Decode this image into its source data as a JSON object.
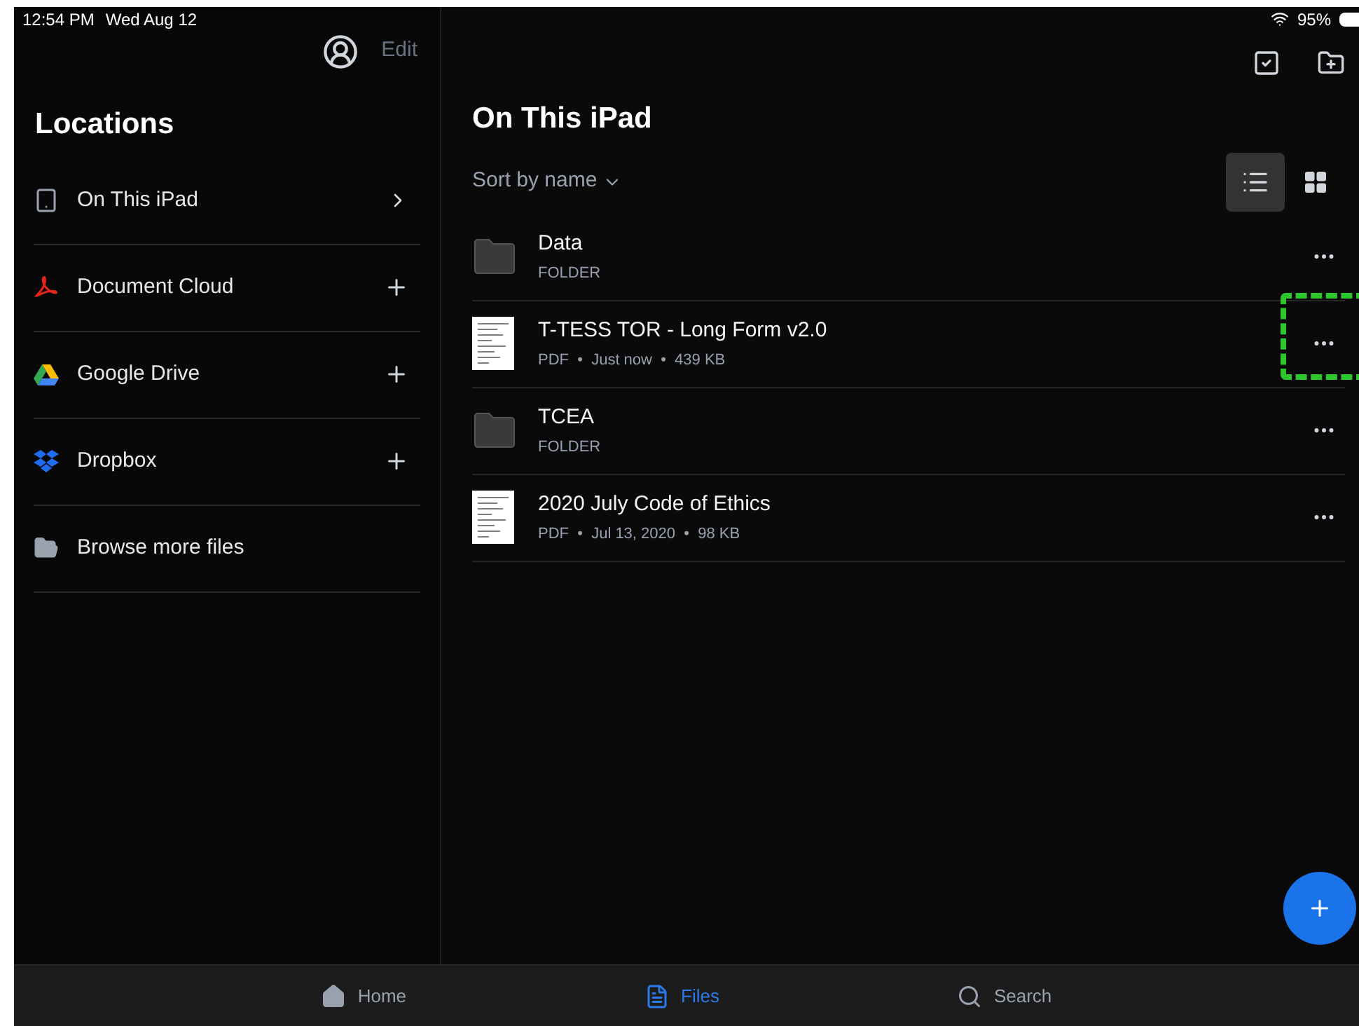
{
  "status_bar": {
    "time": "12:54 PM",
    "date": "Wed Aug 12",
    "battery": "95%"
  },
  "sidebar": {
    "edit": "Edit",
    "title": "Locations",
    "items": [
      {
        "label": "On This iPad",
        "kind": "ipad",
        "accessory": {
          "kind": "chevron"
        }
      },
      {
        "label": "Document Cloud",
        "kind": "acrobat",
        "accessory": {
          "kind": "add"
        }
      },
      {
        "label": "Google Drive",
        "kind": "drive",
        "accessory": {
          "kind": "add"
        }
      },
      {
        "label": "Dropbox",
        "kind": "dropbox",
        "accessory": {
          "kind": "add"
        }
      },
      {
        "label": "Browse more files",
        "kind": "folder"
      }
    ]
  },
  "main": {
    "title": "On This iPad",
    "sort": "Sort by name",
    "views": [
      {
        "kind": "list",
        "selected": true
      },
      {
        "kind": "grid",
        "selected": false
      }
    ],
    "files": [
      {
        "name": "Data",
        "kind": "folder",
        "meta": "FOLDER",
        "highlighted": false
      },
      {
        "name": "T-TESS TOR - Long Form v2.0",
        "kind": "pdf",
        "meta": "PDF  •  Just now  •  439 KB",
        "highlighted": true
      },
      {
        "name": "TCEA",
        "kind": "folder",
        "meta": "FOLDER",
        "highlighted": false
      },
      {
        "name": "2020 July Code of Ethics",
        "kind": "pdf",
        "meta": "PDF  •  Jul 13, 2020  •  98 KB",
        "highlighted": false
      }
    ]
  },
  "tab_bar": [
    {
      "label": "Home",
      "kind": "home",
      "selected": false
    },
    {
      "label": "Files",
      "kind": "files",
      "selected": true
    },
    {
      "label": "Search",
      "kind": "search",
      "selected": false
    }
  ]
}
